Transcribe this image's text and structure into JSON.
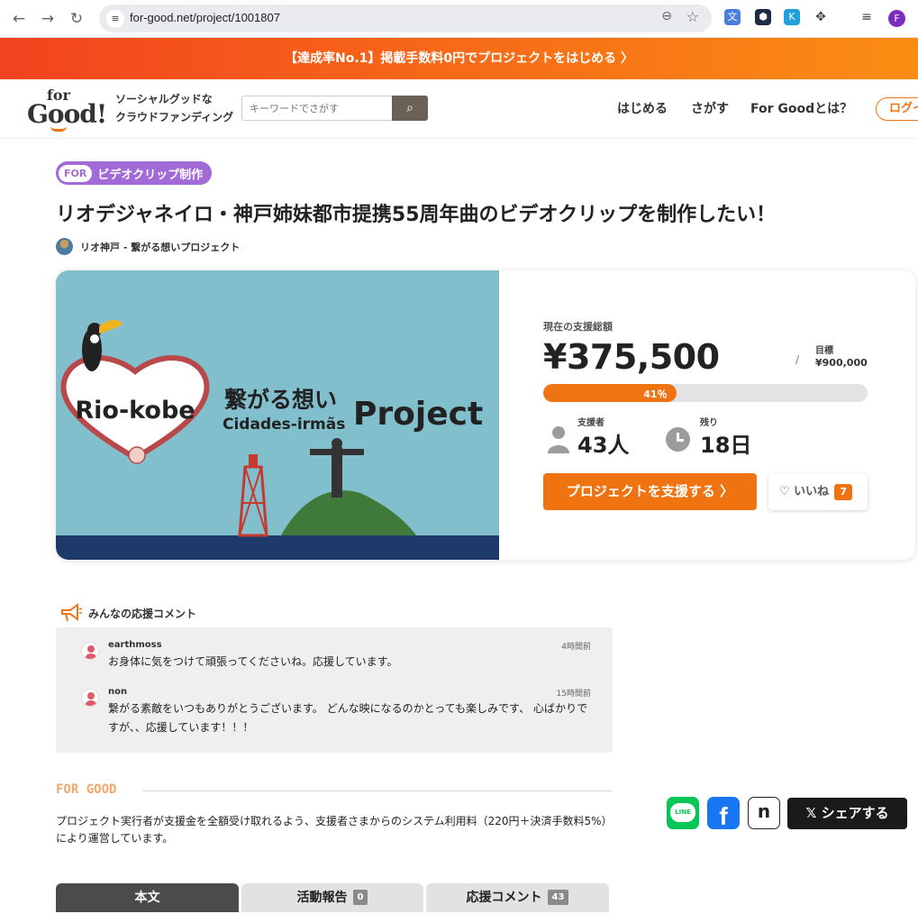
{
  "browser": {
    "url": "for-good.net/project/1001807",
    "profile_initial": "F"
  },
  "promo": {
    "text": "【達成率No.1】掲載手数料0円でプロジェクトをはじめる 〉"
  },
  "header": {
    "logo_for": "for",
    "logo_good": "Good!",
    "tagline_1": "ソーシャルグッドな",
    "tagline_2": "クラウドファンディング",
    "search_placeholder": "キーワードでさがす",
    "nav": [
      "はじめる",
      "さがす",
      "For Goodとは？"
    ],
    "login": "ログイ"
  },
  "project": {
    "category_for": "FOR",
    "category": "ビデオクリップ制作",
    "title": "リオデジャネイロ・神戸姉妹都市提携55周年曲のビデオクリップを制作したい！",
    "owner": "リオ神戸 - 繋がる想いプロジェクト",
    "image_text": {
      "heart": "Rio-kobe",
      "jp": "繋がる想い",
      "pt": "Cidades-irmãs",
      "project": "Project"
    }
  },
  "stats": {
    "total_label": "現在の支援総額",
    "total": "¥375,500",
    "goal_label": "目標",
    "goal": "¥900,000",
    "slash": "/",
    "progress_label": "41％",
    "progress_fraction": 0.41,
    "supporters_label": "支援者",
    "supporters": "43人",
    "remaining_label": "残り",
    "remaining": "18日",
    "support_button": "プロジェクトを支援する 〉",
    "like_label": "♡ いいね",
    "like_count": "7"
  },
  "comments": {
    "heading": "みんなの応援コメント",
    "items": [
      {
        "user": "earthmoss",
        "time": "4時間前",
        "text": "お身体に気をつけて頑張ってくださいね。応援しています。"
      },
      {
        "user": "non",
        "time": "15時間前",
        "text": "繋がる素敵をいつもありがとうございます。 どんな映になるのかとっても楽しみです、 心ばかりですが、、応援しています！！！"
      }
    ]
  },
  "for_good": {
    "title": "FOR GOOD",
    "text": "プロジェクト実行者が支援金を全額受け取れるよう、支援者さまからのシステム利用料（220円＋決済手数料5%）により運営しています。"
  },
  "share": {
    "line": "LINE",
    "facebook": "f",
    "note": "n",
    "x_label": "𝕏 シェアする"
  },
  "tabs": [
    {
      "label": "本文",
      "count": ""
    },
    {
      "label": "活動報告",
      "count": "0"
    },
    {
      "label": "応援コメント",
      "count": "43"
    }
  ],
  "colors": {
    "accent": "#f07312",
    "category": "#a26ad6",
    "image_bg": "#82bfcc"
  }
}
